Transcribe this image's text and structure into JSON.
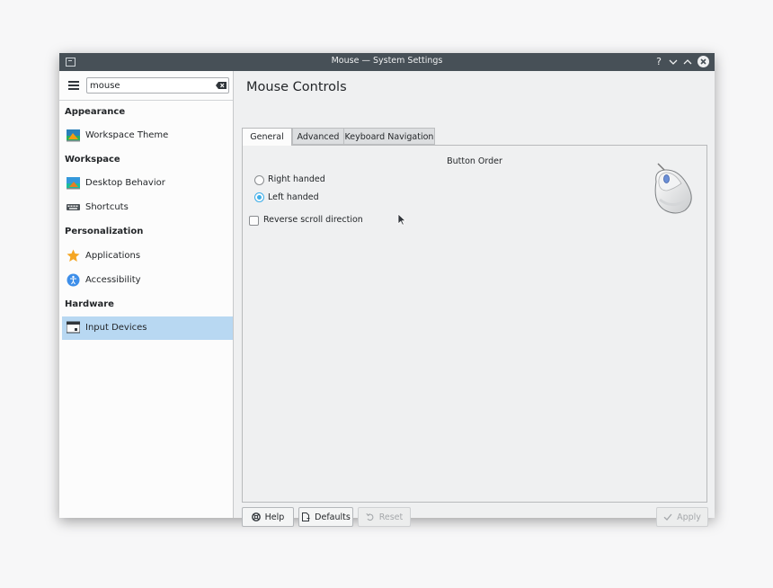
{
  "window": {
    "title": "Mouse — System Settings",
    "controls": {
      "help": "?",
      "minimize": "⌄",
      "maximize": "^",
      "close": "×"
    }
  },
  "sidebar": {
    "search": {
      "value": "mouse",
      "placeholder": ""
    },
    "categories": [
      {
        "label": "Appearance",
        "items": [
          {
            "label": "Workspace Theme",
            "icon": "workspace-theme-icon"
          }
        ]
      },
      {
        "label": "Workspace",
        "items": [
          {
            "label": "Desktop Behavior",
            "icon": "desktop-behavior-icon"
          },
          {
            "label": "Shortcuts",
            "icon": "keyboard-icon"
          }
        ]
      },
      {
        "label": "Personalization",
        "items": [
          {
            "label": "Applications",
            "icon": "star-icon"
          },
          {
            "label": "Accessibility",
            "icon": "accessibility-icon"
          }
        ]
      },
      {
        "label": "Hardware",
        "items": [
          {
            "label": "Input Devices",
            "icon": "input-devices-icon",
            "selected": true
          }
        ]
      }
    ]
  },
  "main": {
    "title": "Mouse Controls",
    "tabs": [
      {
        "label": "General",
        "active": true
      },
      {
        "label": "Advanced",
        "active": false
      },
      {
        "label": "Keyboard Navigation",
        "active": false
      }
    ],
    "general": {
      "button_order_title": "Button Order",
      "options": [
        {
          "label": "Right handed",
          "checked": false
        },
        {
          "label": "Left handed",
          "checked": true
        }
      ],
      "reverse_scroll": {
        "label": "Reverse scroll direction",
        "checked": false
      }
    },
    "buttons": {
      "help": "Help",
      "defaults": "Defaults",
      "reset": "Reset",
      "apply": "Apply"
    }
  },
  "colors": {
    "accent": "#3daee9",
    "titlebar": "#475057",
    "selection": "#b8d8f2"
  }
}
